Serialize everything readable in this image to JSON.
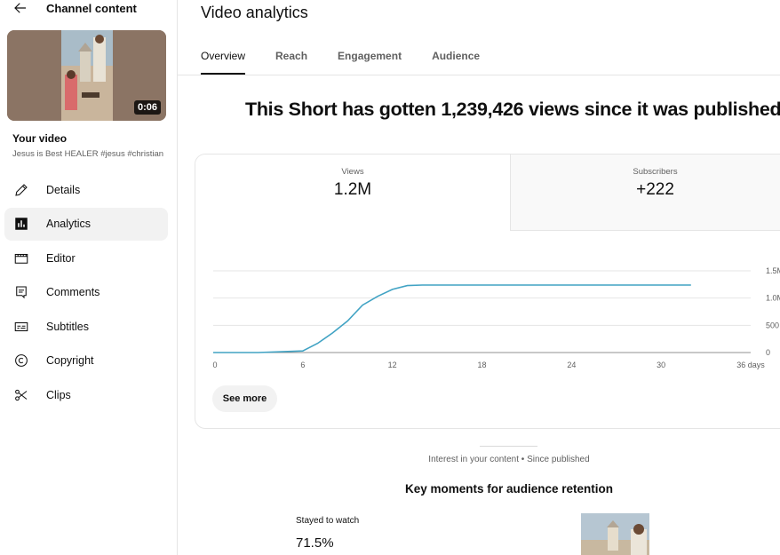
{
  "sidebar": {
    "back_label": "Channel content",
    "thumbnail": {
      "duration": "0:06"
    },
    "your_video_label": "Your video",
    "video_title": "Jesus is Best HEALER #jesus #christian",
    "items": [
      {
        "label": "Details",
        "icon": "pencil-icon",
        "active": false
      },
      {
        "label": "Analytics",
        "icon": "analytics-icon",
        "active": true
      },
      {
        "label": "Editor",
        "icon": "clapper-icon",
        "active": false
      },
      {
        "label": "Comments",
        "icon": "comment-icon",
        "active": false
      },
      {
        "label": "Subtitles",
        "icon": "subtitles-icon",
        "active": false
      },
      {
        "label": "Copyright",
        "icon": "copyright-icon",
        "active": false
      },
      {
        "label": "Clips",
        "icon": "scissors-icon",
        "active": false
      }
    ]
  },
  "main": {
    "title": "Video analytics",
    "tabs": [
      {
        "label": "Overview",
        "active": true
      },
      {
        "label": "Reach",
        "active": false
      },
      {
        "label": "Engagement",
        "active": false
      },
      {
        "label": "Audience",
        "active": false
      }
    ],
    "headline": "This Short has gotten 1,239,426 views since it was published",
    "metrics": {
      "views": {
        "label": "Views",
        "value": "1.2M"
      },
      "subscribers": {
        "label": "Subscribers",
        "value": "+222"
      }
    },
    "see_more_label": "See more",
    "interest_text": "Interest in your content • Since published",
    "key_moments_title": "Key moments for audience retention",
    "stayed_label": "Stayed to watch",
    "stayed_value": "71.5%"
  },
  "colors": {
    "line": "#41a3c4",
    "grid": "#e5e5e5",
    "active_nav": "#f2f2f2"
  },
  "chart_data": {
    "type": "line",
    "xlabel": "",
    "ylabel": "",
    "x_ticks": [
      "0",
      "6",
      "12",
      "18",
      "24",
      "30",
      "36 days"
    ],
    "x_tick_values": [
      0,
      6,
      12,
      18,
      24,
      30,
      36
    ],
    "y_ticks": [
      "0",
      "500",
      "1.0M",
      "1.5M"
    ],
    "y_tick_values": [
      0,
      500000,
      1000000,
      1500000
    ],
    "xlim": [
      0,
      36
    ],
    "ylim": [
      0,
      1500000
    ],
    "grid": true,
    "series": [
      {
        "x": [
          0,
          3,
          5,
          6,
          7,
          8,
          9,
          10,
          11,
          12,
          13,
          14,
          18,
          24,
          30,
          32
        ],
        "y": [
          0,
          0,
          20000,
          30000,
          170000,
          360000,
          580000,
          870000,
          1030000,
          1160000,
          1230000,
          1239000,
          1239000,
          1239000,
          1239000,
          1239000
        ]
      }
    ]
  }
}
